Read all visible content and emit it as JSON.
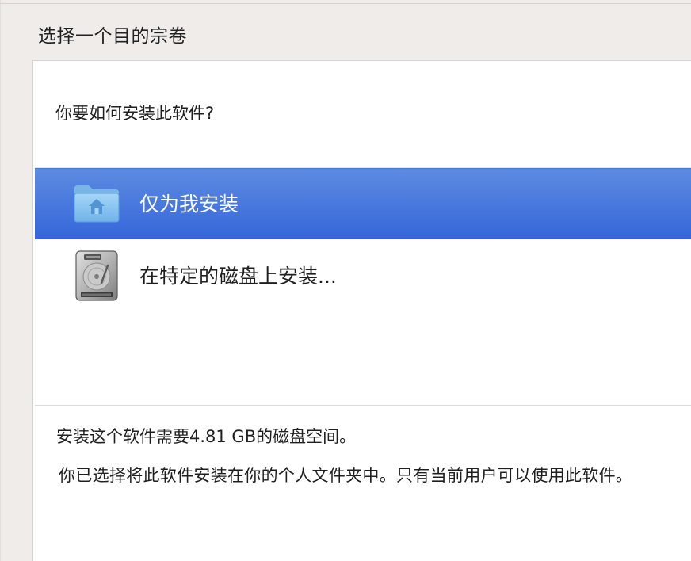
{
  "section_title": "选择一个目的宗卷",
  "question": "你要如何安装此软件?",
  "options": [
    {
      "label": "仅为我安装",
      "icon": "home-folder-icon",
      "selected": true
    },
    {
      "label": "在特定的磁盘上安装...",
      "icon": "hard-disk-icon",
      "selected": false
    }
  ],
  "space_note": "安装这个软件需要4.81 GB的磁盘空间。",
  "install_description": "你已选择将此软件安装在你的个人文件夹中。只有当前用户可以使用此软件。",
  "colors": {
    "selection": "#3f72dc",
    "background": "#f0ecea",
    "panel": "#ffffff"
  }
}
